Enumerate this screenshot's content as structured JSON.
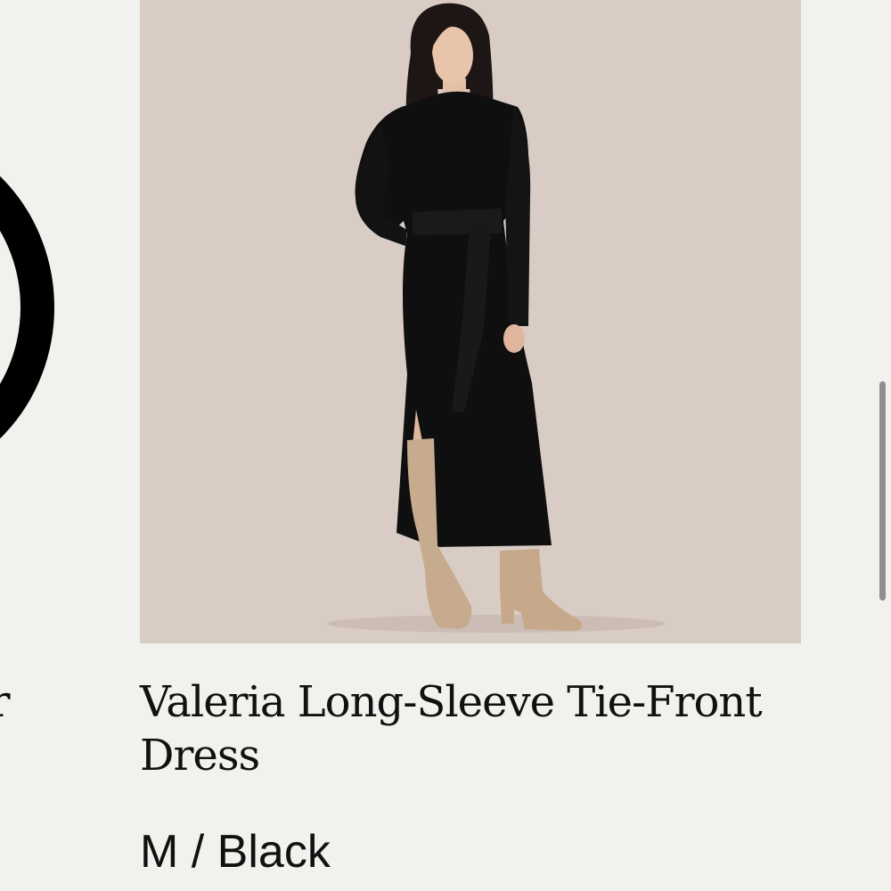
{
  "previous_product": {
    "title_fragment": "ter"
  },
  "product": {
    "image": {
      "alt": "Woman wearing black long-sleeve tie-front dress with tan knee-high boots",
      "background_color": "#d9ccc5"
    },
    "title": "Valeria Long-Sleeve Tie-Front Dress",
    "variant": "M / Black"
  },
  "colors": {
    "page_background": "#f1f1ed",
    "text": "#111111",
    "scrollbar": "#8e8e8c"
  }
}
